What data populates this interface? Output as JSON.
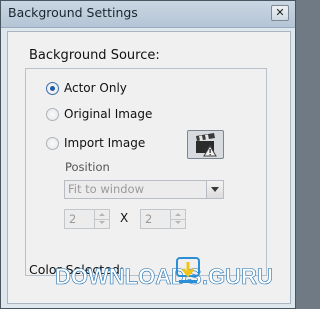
{
  "window": {
    "title": "Background Settings",
    "close_glyph": "✕"
  },
  "background_source": {
    "heading": "Background Source:",
    "options": [
      {
        "label": "Actor Only",
        "selected": true
      },
      {
        "label": "Original Image",
        "selected": false
      },
      {
        "label": "Import Image",
        "selected": false
      }
    ],
    "import_icon": "clapperboard-warning-icon"
  },
  "position": {
    "label": "Position",
    "mode_select": {
      "value": "Fit to window"
    },
    "columns": {
      "value": "2"
    },
    "separator": "X",
    "rows": {
      "value": "2"
    }
  },
  "color": {
    "label": "Color Selected:"
  },
  "watermark": {
    "text": "DOWNLOADS",
    "suffix": ".GURU"
  },
  "colors": {
    "accent": "#1f5da6",
    "watermark": "#2a8fd6"
  }
}
